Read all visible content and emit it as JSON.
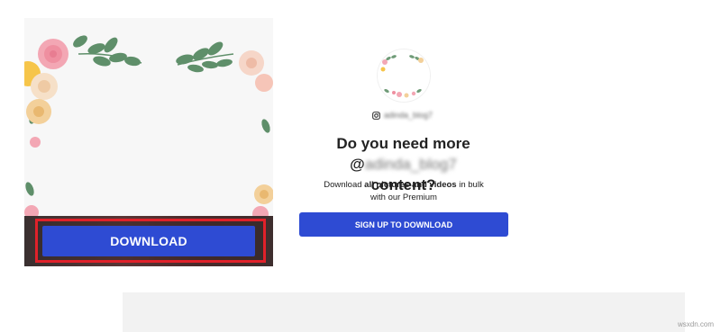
{
  "preview": {
    "download_label": "DOWNLOAD"
  },
  "profile": {
    "handle": "adinda_blog7",
    "headline_prefix": "Do you need more @",
    "headline_handle": "adinda_blog7",
    "headline_suffix": "content?",
    "sub_pre": "Download ",
    "sub_bold": "all pictures and videos",
    "sub_post": " in bulk",
    "sub_line2": "with our Premium",
    "signup_label": "SIGN UP TO DOWNLOAD"
  },
  "watermark": "wsxdn.com",
  "colors": {
    "accent_blue": "#2e4bd3",
    "highlight_red": "#e0212a"
  }
}
